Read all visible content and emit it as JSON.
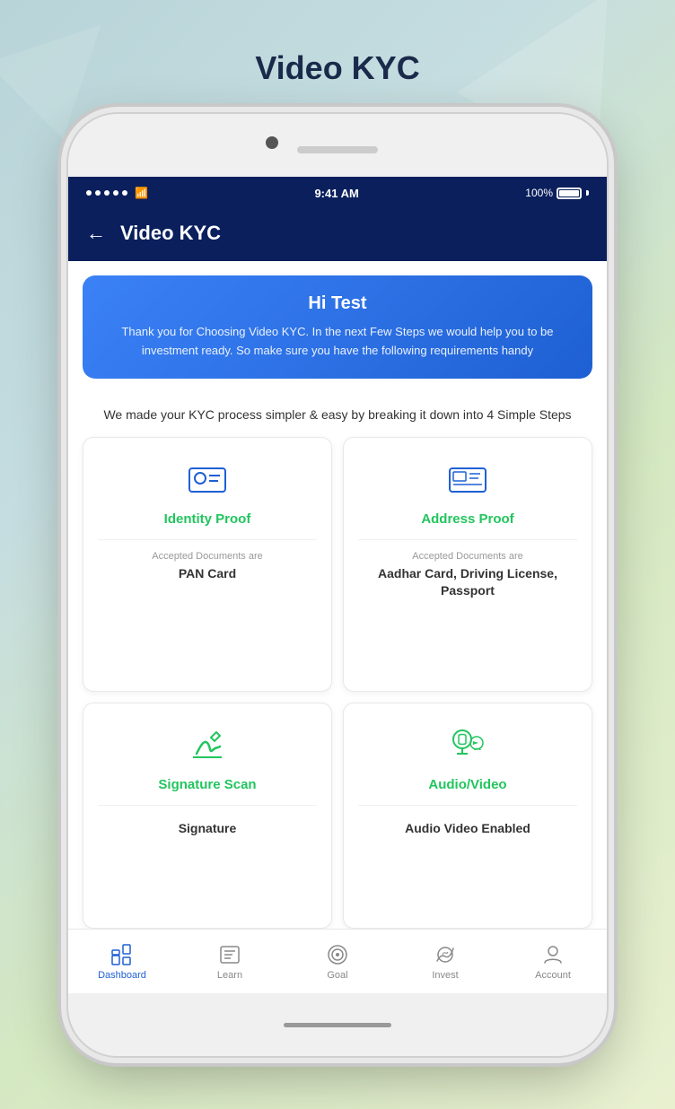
{
  "page": {
    "title": "Video KYC"
  },
  "statusBar": {
    "time": "9:41 AM",
    "battery": "100%"
  },
  "header": {
    "title": "Video KYC",
    "backLabel": "←"
  },
  "banner": {
    "title": "Hi Test",
    "text": "Thank you for Choosing Video KYC. In the next Few Steps we would help you to be investment ready. So make sure you have the following requirements handy"
  },
  "stepsDesc": "We made your KYC process simpler & easy by breaking it down into 4 Simple Steps",
  "cards": [
    {
      "id": "identity",
      "title": "Identity Proof",
      "subtitle": "Accepted Documents are",
      "document": "PAN Card"
    },
    {
      "id": "address",
      "title": "Address Proof",
      "subtitle": "Accepted Documents are",
      "document": "Aadhar Card, Driving License, Passport"
    },
    {
      "id": "signature",
      "title": "Signature Scan",
      "subtitle": "",
      "document": "Signature"
    },
    {
      "id": "audiovideo",
      "title": "Audio/Video",
      "subtitle": "",
      "document": "Audio Video Enabled"
    }
  ],
  "bottomNav": [
    {
      "label": "Dashboard",
      "active": true
    },
    {
      "label": "Learn",
      "active": false
    },
    {
      "label": "Goal",
      "active": false
    },
    {
      "label": "Invest",
      "active": false
    },
    {
      "label": "Account",
      "active": false
    }
  ]
}
